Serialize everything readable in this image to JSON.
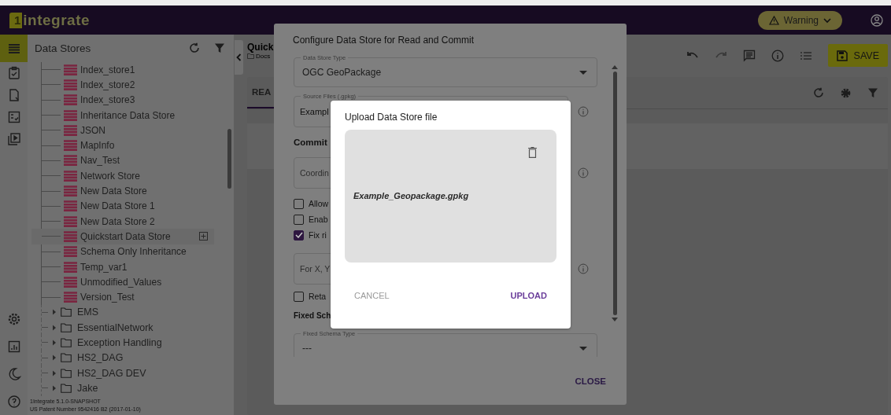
{
  "header": {
    "logo_digit": "1",
    "logo_text": "integrate",
    "warning": "Warning"
  },
  "rail": [
    {
      "kind": "list",
      "selected": true
    },
    {
      "kind": "clipboard",
      "selected": false
    },
    {
      "kind": "file",
      "selected": false
    },
    {
      "kind": "checklist",
      "selected": false
    },
    {
      "kind": "play",
      "selected": false
    },
    {
      "kind": "gear",
      "selected": false
    },
    {
      "kind": "chart",
      "selected": false
    },
    {
      "kind": "moon",
      "selected": false
    },
    {
      "kind": "help",
      "selected": false
    }
  ],
  "sidebar": {
    "title": "Data Stores",
    "stores": [
      {
        "label": "Index_store1",
        "selected": false
      },
      {
        "label": "Index_store2",
        "selected": false
      },
      {
        "label": "Index_store3",
        "selected": false
      },
      {
        "label": "Inheritance Data Store",
        "selected": false
      },
      {
        "label": "JSON",
        "selected": false
      },
      {
        "label": "MapInfo",
        "selected": false
      },
      {
        "label": "Nav_Test",
        "selected": false
      },
      {
        "label": "Network Store",
        "selected": false
      },
      {
        "label": "New Data Store",
        "selected": false
      },
      {
        "label": "New Data Store 1",
        "selected": false
      },
      {
        "label": "New Data Store 2",
        "selected": false
      },
      {
        "label": "Quickstart Data Store",
        "selected": true
      },
      {
        "label": "Schema Only Inheritance",
        "selected": false
      },
      {
        "label": "Temp_var1",
        "selected": false
      },
      {
        "label": "Unmodified_Values",
        "selected": false
      },
      {
        "label": "Version_Test",
        "selected": false
      }
    ],
    "folders": [
      {
        "label": "EMS",
        "expanded": false
      },
      {
        "label": "EssentialNetwork",
        "expanded": false
      },
      {
        "label": "Exception Handling",
        "expanded": false
      },
      {
        "label": "HS2_DAG",
        "expanded": false
      },
      {
        "label": "HS2_DAG DEV",
        "expanded": false
      },
      {
        "label": "Jake",
        "expanded": false
      }
    ],
    "footer": [
      "1Integrate 5.1.0-SNAPSHOT",
      "US Patent Number 9542416 B2 (2017-01-10)"
    ]
  },
  "main": {
    "title": "Quick",
    "breadcrumb": "Docs",
    "tabs": [
      {
        "label": "REA",
        "selected": true
      }
    ],
    "save": "SAVE"
  },
  "config": {
    "title": "Configure Data Store for Read and Commit",
    "close": "CLOSE",
    "items": [
      {
        "kind": "select",
        "label": "Data Store Type",
        "value": "OGC GeoPackage"
      },
      {
        "kind": "field",
        "label": "Source Files (.gpkg)",
        "value": "Exampl"
      },
      {
        "kind": "heading",
        "label": "Commit"
      },
      {
        "kind": "field",
        "placeholder": "Coordin"
      },
      {
        "kind": "checkbox",
        "label": "Allow",
        "checked": false
      },
      {
        "kind": "checkbox",
        "label": "Enab",
        "checked": false
      },
      {
        "kind": "checkbox",
        "label": "Fix ri",
        "checked": true
      },
      {
        "kind": "field",
        "placeholder": "For X, Y"
      },
      {
        "kind": "checkbox",
        "label": "Reta",
        "checked": false
      },
      {
        "kind": "heading",
        "label": "Fixed Sch"
      },
      {
        "kind": "select",
        "label": "Fixed Schema Type",
        "value": "---"
      }
    ]
  },
  "upload": {
    "title": "Upload Data Store file",
    "file": "Example_Geopackage.gpkg",
    "cancel": "CANCEL",
    "upload": "UPLOAD"
  }
}
